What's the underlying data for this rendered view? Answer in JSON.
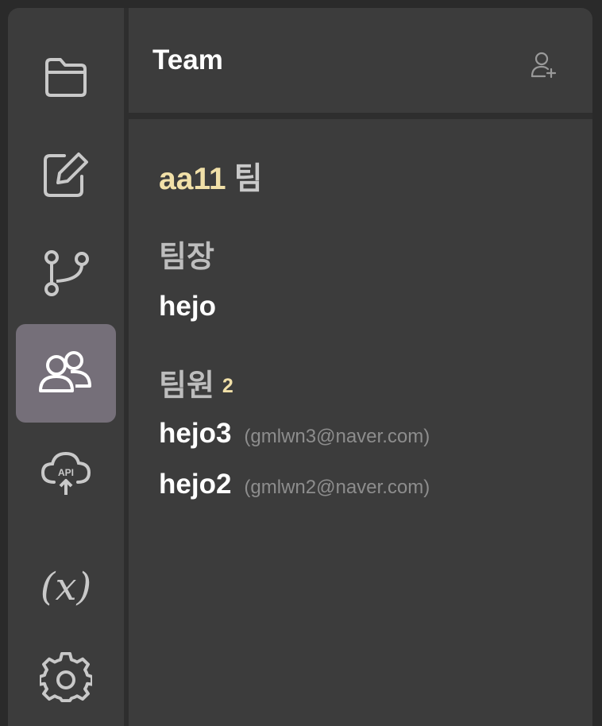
{
  "header": {
    "title": "Team"
  },
  "sidebar": {
    "items": [
      {
        "icon": "folder-icon",
        "active": false
      },
      {
        "icon": "edit-icon",
        "active": false
      },
      {
        "icon": "branch-icon",
        "active": false
      },
      {
        "icon": "users-icon",
        "active": true
      },
      {
        "icon": "cloud-api-icon",
        "label": "API",
        "active": false
      },
      {
        "icon": "variable-icon",
        "label": "(x)",
        "active": false
      },
      {
        "icon": "gear-icon",
        "active": false
      }
    ]
  },
  "team": {
    "id": "aa11",
    "suffix": "팀",
    "leader_label": "팀장",
    "leader": "hejo",
    "members_label": "팀원",
    "member_count": "2",
    "members": [
      {
        "name": "hejo3",
        "email": "(gmlwn3@naver.com)"
      },
      {
        "name": "hejo2",
        "email": "(gmlwn2@naver.com)"
      }
    ]
  },
  "colors": {
    "accent": "#f1e0a8",
    "active_bg": "#756f79",
    "panel_bg": "#3c3c3c"
  }
}
